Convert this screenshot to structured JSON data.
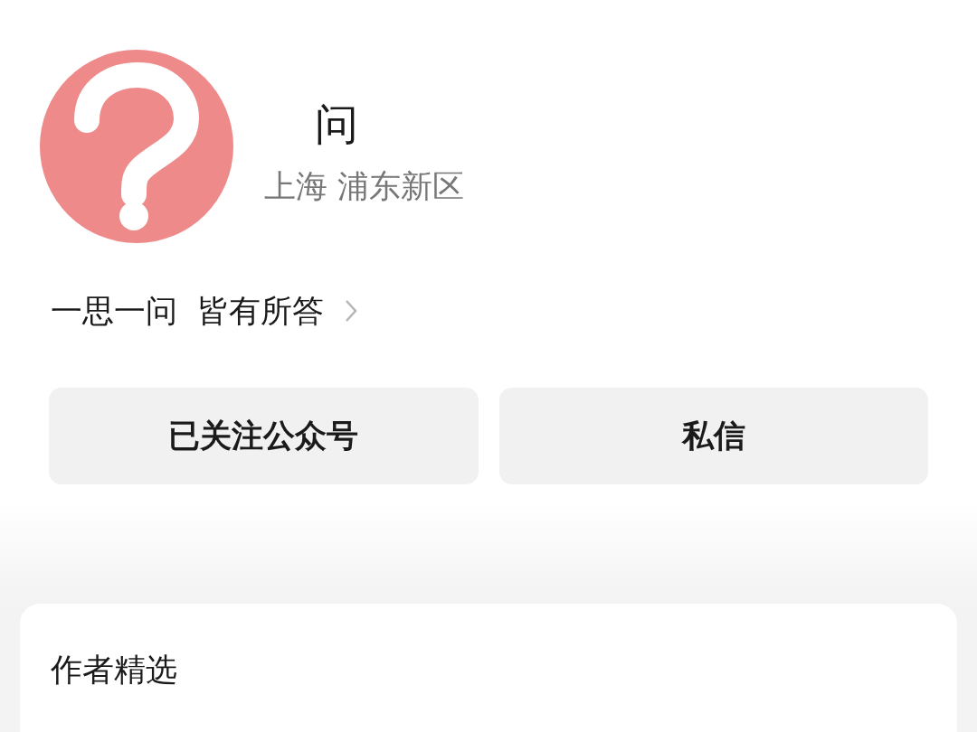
{
  "profile": {
    "name": "问",
    "location": "上海 浦东新区"
  },
  "bio": {
    "text": "一思一问  皆有所答"
  },
  "buttons": [
    {
      "label": "已关注公众号"
    },
    {
      "label": "私信"
    }
  ],
  "section": {
    "title": "作者精选"
  }
}
